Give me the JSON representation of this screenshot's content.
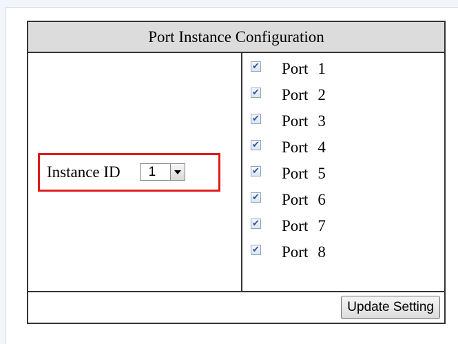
{
  "table": {
    "title": "Port Instance Configuration"
  },
  "instance": {
    "label": "Instance ID",
    "selected_value": "1"
  },
  "ports": [
    {
      "word": "Port",
      "number": "1",
      "checked": true
    },
    {
      "word": "Port",
      "number": "2",
      "checked": true
    },
    {
      "word": "Port",
      "number": "3",
      "checked": true
    },
    {
      "word": "Port",
      "number": "4",
      "checked": true
    },
    {
      "word": "Port",
      "number": "5",
      "checked": true
    },
    {
      "word": "Port",
      "number": "6",
      "checked": true
    },
    {
      "word": "Port",
      "number": "7",
      "checked": true
    },
    {
      "word": "Port",
      "number": "8",
      "checked": true
    }
  ],
  "actions": {
    "update_label": "Update Setting"
  },
  "colors": {
    "highlight_border": "#e01b1b",
    "header_background": "#dcdcdc",
    "checkmark": "#2f4fa8"
  },
  "icons": {
    "dropdown": "chevron-down-icon",
    "checkbox_checked": "checkmark-icon"
  }
}
